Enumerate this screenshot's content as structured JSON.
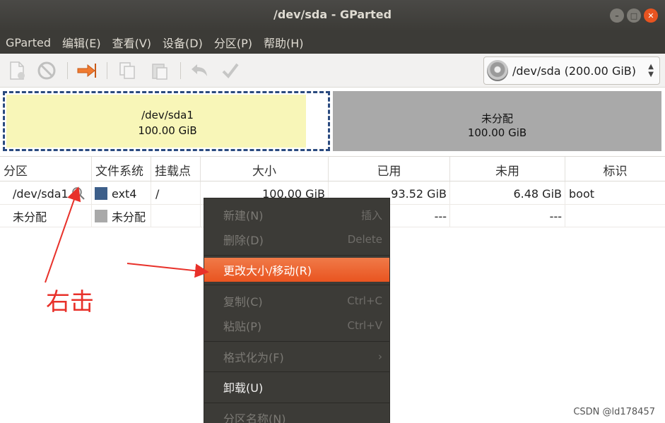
{
  "window": {
    "title": "/dev/sda - GParted"
  },
  "menubar": [
    "GParted",
    "编辑(E)",
    "查看(V)",
    "设备(D)",
    "分区(P)",
    "帮助(H)"
  ],
  "toolbar": {
    "device_selector": "/dev/sda  (200.00 GiB)"
  },
  "disk_visual": {
    "partitions": [
      {
        "name": "/dev/sda1",
        "size": "100.00 GiB",
        "used_fraction": 0.935
      },
      {
        "name": "未分配",
        "size": "100.00 GiB"
      }
    ]
  },
  "table": {
    "columns": [
      "分区",
      "文件系统",
      "挂载点",
      "大小",
      "已用",
      "未用",
      "标识"
    ],
    "rows": [
      {
        "partition": "/dev/sda1",
        "fs": "ext4",
        "fs_color": "#3d5f8a",
        "mount": "/",
        "size": "100.00 GiB",
        "used": "93.52 GiB",
        "unused": "6.48 GiB",
        "flags": "boot"
      },
      {
        "partition": "未分配",
        "fs": "未分配",
        "fs_color": "#a9a9a9",
        "mount": "",
        "size": "",
        "used": "---",
        "unused": "---",
        "flags": ""
      }
    ]
  },
  "context_menu": {
    "items": [
      {
        "label": "新建(N)",
        "shortcut": "插入"
      },
      {
        "label": "删除(D)",
        "shortcut": "Delete"
      },
      {
        "label": "更改大小/移动(R)",
        "shortcut": ""
      },
      {
        "label": "复制(C)",
        "shortcut": "Ctrl+C"
      },
      {
        "label": "粘贴(P)",
        "shortcut": "Ctrl+V"
      },
      {
        "label": "格式化为(F)",
        "shortcut": "›"
      },
      {
        "label": "卸载(U)",
        "shortcut": ""
      },
      {
        "label": "分区名称(N)",
        "shortcut": ""
      }
    ]
  },
  "annotation": {
    "text": "右击",
    "color": "#e8312a"
  },
  "watermark": "CSDN @ld178457",
  "colors": {
    "titlebar": "#3c3b37",
    "accent": "#e95420",
    "partition_fill": "#f8f6b8",
    "unallocated": "#a9a9a9"
  }
}
